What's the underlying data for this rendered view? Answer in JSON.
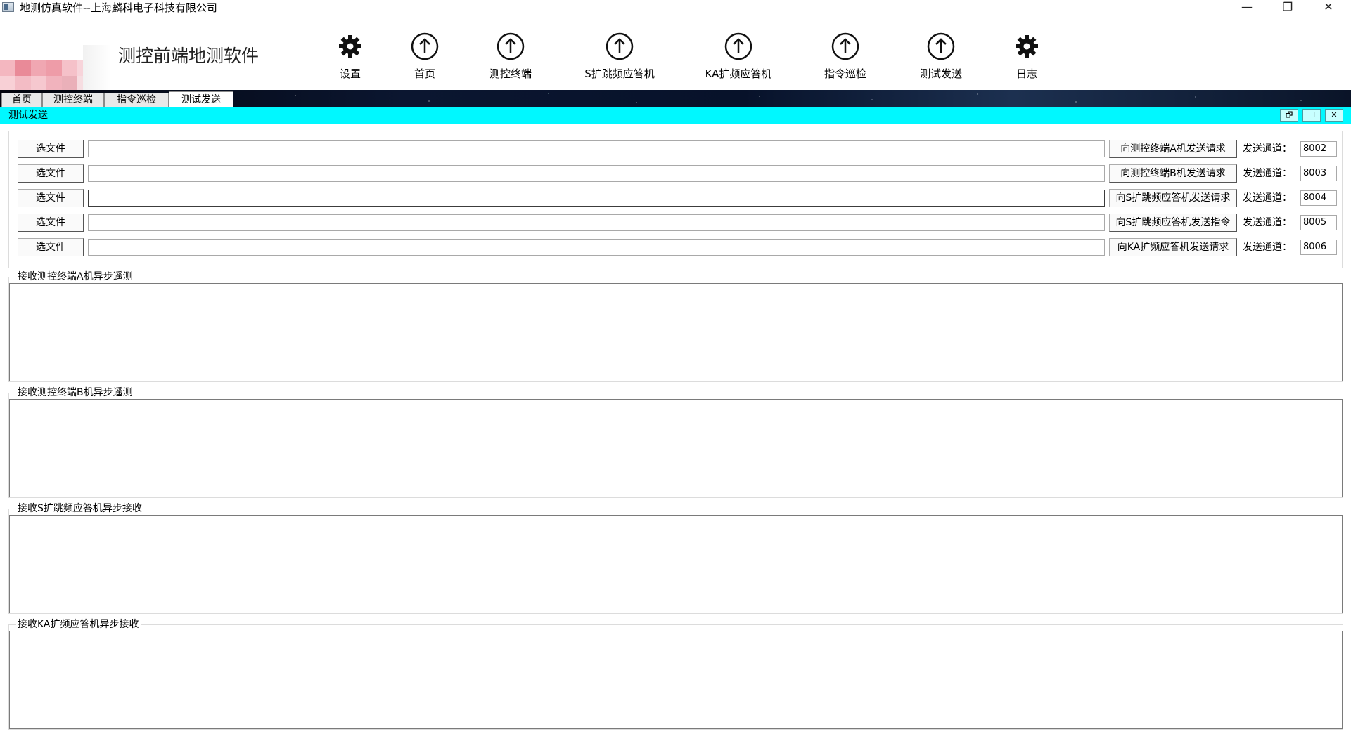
{
  "window": {
    "title": "地测仿真软件--上海麟科电子科技有限公司",
    "min_symbol": "—",
    "max_symbol": "❐",
    "close_symbol": "✕"
  },
  "header": {
    "app_name": "测控前端地测软件",
    "toolbar": [
      {
        "label": "设置",
        "icon": "gear-icon"
      },
      {
        "label": "首页",
        "icon": "upload-arrow-icon"
      },
      {
        "label": "测控终端",
        "icon": "upload-arrow-icon"
      },
      {
        "label": "S扩跳频应答机",
        "icon": "upload-arrow-icon"
      },
      {
        "label": "KA扩频应答机",
        "icon": "upload-arrow-icon"
      },
      {
        "label": "指令巡检",
        "icon": "upload-arrow-icon"
      },
      {
        "label": "测试发送",
        "icon": "upload-arrow-icon"
      },
      {
        "label": "日志",
        "icon": "gear-icon"
      }
    ]
  },
  "tabs": [
    {
      "label": "首页"
    },
    {
      "label": "测控终端"
    },
    {
      "label": "指令巡检"
    },
    {
      "label": "测试发送"
    }
  ],
  "active_tab": "测试发送",
  "panel": {
    "title": "测试发送",
    "restore_symbol": "🗗",
    "maximize_symbol": "☐",
    "close_symbol": "✕"
  },
  "send_rows": [
    {
      "file_button": "选文件",
      "path": "",
      "request_button": "向测控终端A机发送请求",
      "channel_label": "发送通道：",
      "channel": "8002"
    },
    {
      "file_button": "选文件",
      "path": "",
      "request_button": "向测控终端B机发送请求",
      "channel_label": "发送通道：",
      "channel": "8003"
    },
    {
      "file_button": "选文件",
      "path": "",
      "request_button": "向S扩跳频应答机发送请求",
      "channel_label": "发送通道：",
      "channel": "8004"
    },
    {
      "file_button": "选文件",
      "path": "",
      "request_button": "向S扩跳频应答机发送指令",
      "channel_label": "发送通道：",
      "channel": "8005"
    },
    {
      "file_button": "选文件",
      "path": "",
      "request_button": "向KA扩频应答机发送请求",
      "channel_label": "发送通道：",
      "channel": "8006"
    }
  ],
  "receive_groups": [
    {
      "title": "接收测控终端A机异步遥测",
      "content": ""
    },
    {
      "title": "接收测控终端B机异步遥测",
      "content": ""
    },
    {
      "title": "接收S扩跳频应答机异步接收",
      "content": ""
    },
    {
      "title": "接收KA扩频应答机异步接收",
      "content": ""
    }
  ],
  "colors": {
    "panel_bar": "#00f8ff",
    "tabstrip": "#0b1630"
  }
}
